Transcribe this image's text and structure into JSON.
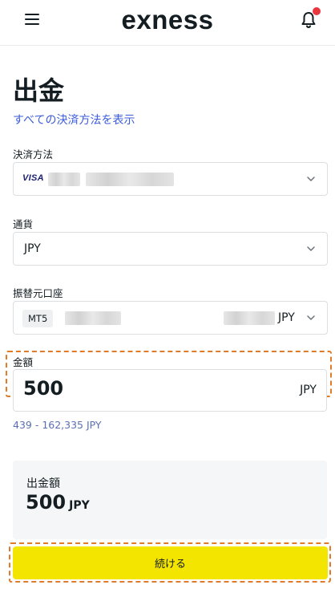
{
  "header": {
    "logo_text": "exness",
    "menu_icon": "hamburger-icon",
    "notification_icon": "bell-icon",
    "notification_dot_color": "#e8373e"
  },
  "page": {
    "title": "出金",
    "show_all_methods_link": "すべての決済方法を表示"
  },
  "payment_method": {
    "label": "決済方法",
    "brand": "VISA"
  },
  "currency": {
    "label": "通貨",
    "value": "JPY"
  },
  "source_account": {
    "label": "振替元口座",
    "platform_badge": "MT5",
    "currency": "JPY"
  },
  "amount": {
    "label": "金額",
    "value": "500",
    "currency": "JPY",
    "range": "439 - 162,335 JPY"
  },
  "summary": {
    "label": "出金額",
    "value": "500",
    "currency": "JPY"
  },
  "cta": {
    "label": "続ける",
    "color": "#f3e500"
  },
  "highlight_color": "#e07b2a"
}
